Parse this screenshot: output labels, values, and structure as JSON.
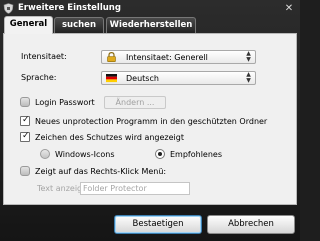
{
  "window": {
    "title": "Erweitere Einstellung",
    "close_glyph": "✕"
  },
  "tabs": [
    {
      "label": "General",
      "active": true
    },
    {
      "label": "suchen",
      "active": false
    },
    {
      "label": "Wiederherstellen",
      "active": false
    }
  ],
  "general": {
    "intensity": {
      "label": "Intensitaet:",
      "value": "Intensitaet: Generell",
      "icon": "lock-icon"
    },
    "language": {
      "label": "Sprache:",
      "value": "Deutsch",
      "icon": "german-flag-icon"
    },
    "login_password": {
      "label": "Login Passwort",
      "checked": false,
      "change_button": "Ändern ..."
    },
    "new_unprotection": {
      "label": "Neues unprotection Programm in den geschützten Ordner",
      "checked": true
    },
    "show_protection_sign": {
      "label": "Zeichen des Schutzes wird angezeigt",
      "checked": true
    },
    "icon_options": [
      {
        "label": "Windows-Icons",
        "selected": false
      },
      {
        "label": "Empfohlenes",
        "selected": true
      }
    ],
    "context_menu": {
      "label": "Zeigt auf das Rechts-Klick Menü:",
      "checked": false,
      "text_label": "Text anzeigen",
      "text_value": "Folder Protector"
    }
  },
  "buttons": {
    "ok": "Bestaetigen",
    "cancel": "Abbrechen"
  },
  "colors": {
    "window_bg": "#1e1e1e",
    "panel_bg": "#f0f0f0",
    "accent": "#3c7fb1",
    "lock_gold": "#d4a017"
  }
}
